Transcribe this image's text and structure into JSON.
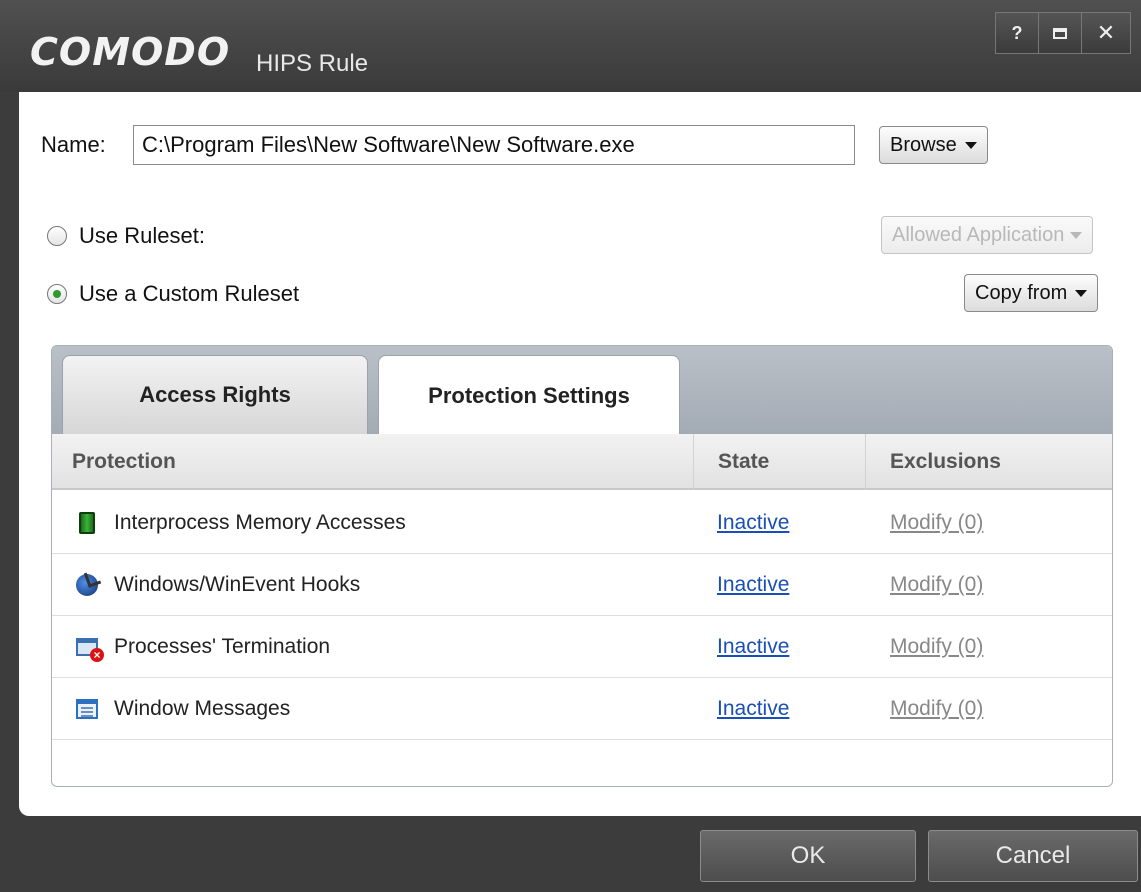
{
  "window": {
    "logo": "COMODO",
    "title": "HIPS Rule",
    "controls": {
      "help": "?",
      "close": "✕"
    }
  },
  "name": {
    "label": "Name:",
    "value": "C:\\Program Files\\New Software\\New Software.exe",
    "browse_label": "Browse"
  },
  "ruleset": {
    "use_ruleset_label": "Use Ruleset:",
    "use_ruleset_checked": false,
    "ruleset_select_value": "Allowed Application",
    "use_custom_label": "Use a Custom Ruleset",
    "use_custom_checked": true,
    "copy_from_label": "Copy from"
  },
  "tabs": [
    {
      "label": "Access Rights",
      "active": false
    },
    {
      "label": "Protection Settings",
      "active": true
    }
  ],
  "grid": {
    "columns": [
      "Protection",
      "State",
      "Exclusions"
    ],
    "rows": [
      {
        "icon": "memory-chip-icon",
        "protection": "Interprocess Memory Accesses",
        "state": "Inactive",
        "exclusions": "Modify (0)"
      },
      {
        "icon": "hook-icon",
        "protection": "Windows/WinEvent Hooks",
        "state": "Inactive",
        "exclusions": "Modify (0)"
      },
      {
        "icon": "process-terminate-icon",
        "protection": "Processes' Termination",
        "state": "Inactive",
        "exclusions": "Modify (0)"
      },
      {
        "icon": "window-message-icon",
        "protection": "Window Messages",
        "state": "Inactive",
        "exclusions": "Modify (0)"
      }
    ]
  },
  "footer": {
    "ok_label": "OK",
    "cancel_label": "Cancel"
  },
  "colors": {
    "link": "#1a4fb8",
    "checked_radio": "#2d9a2d",
    "titlebar": "#3c3c3c"
  }
}
